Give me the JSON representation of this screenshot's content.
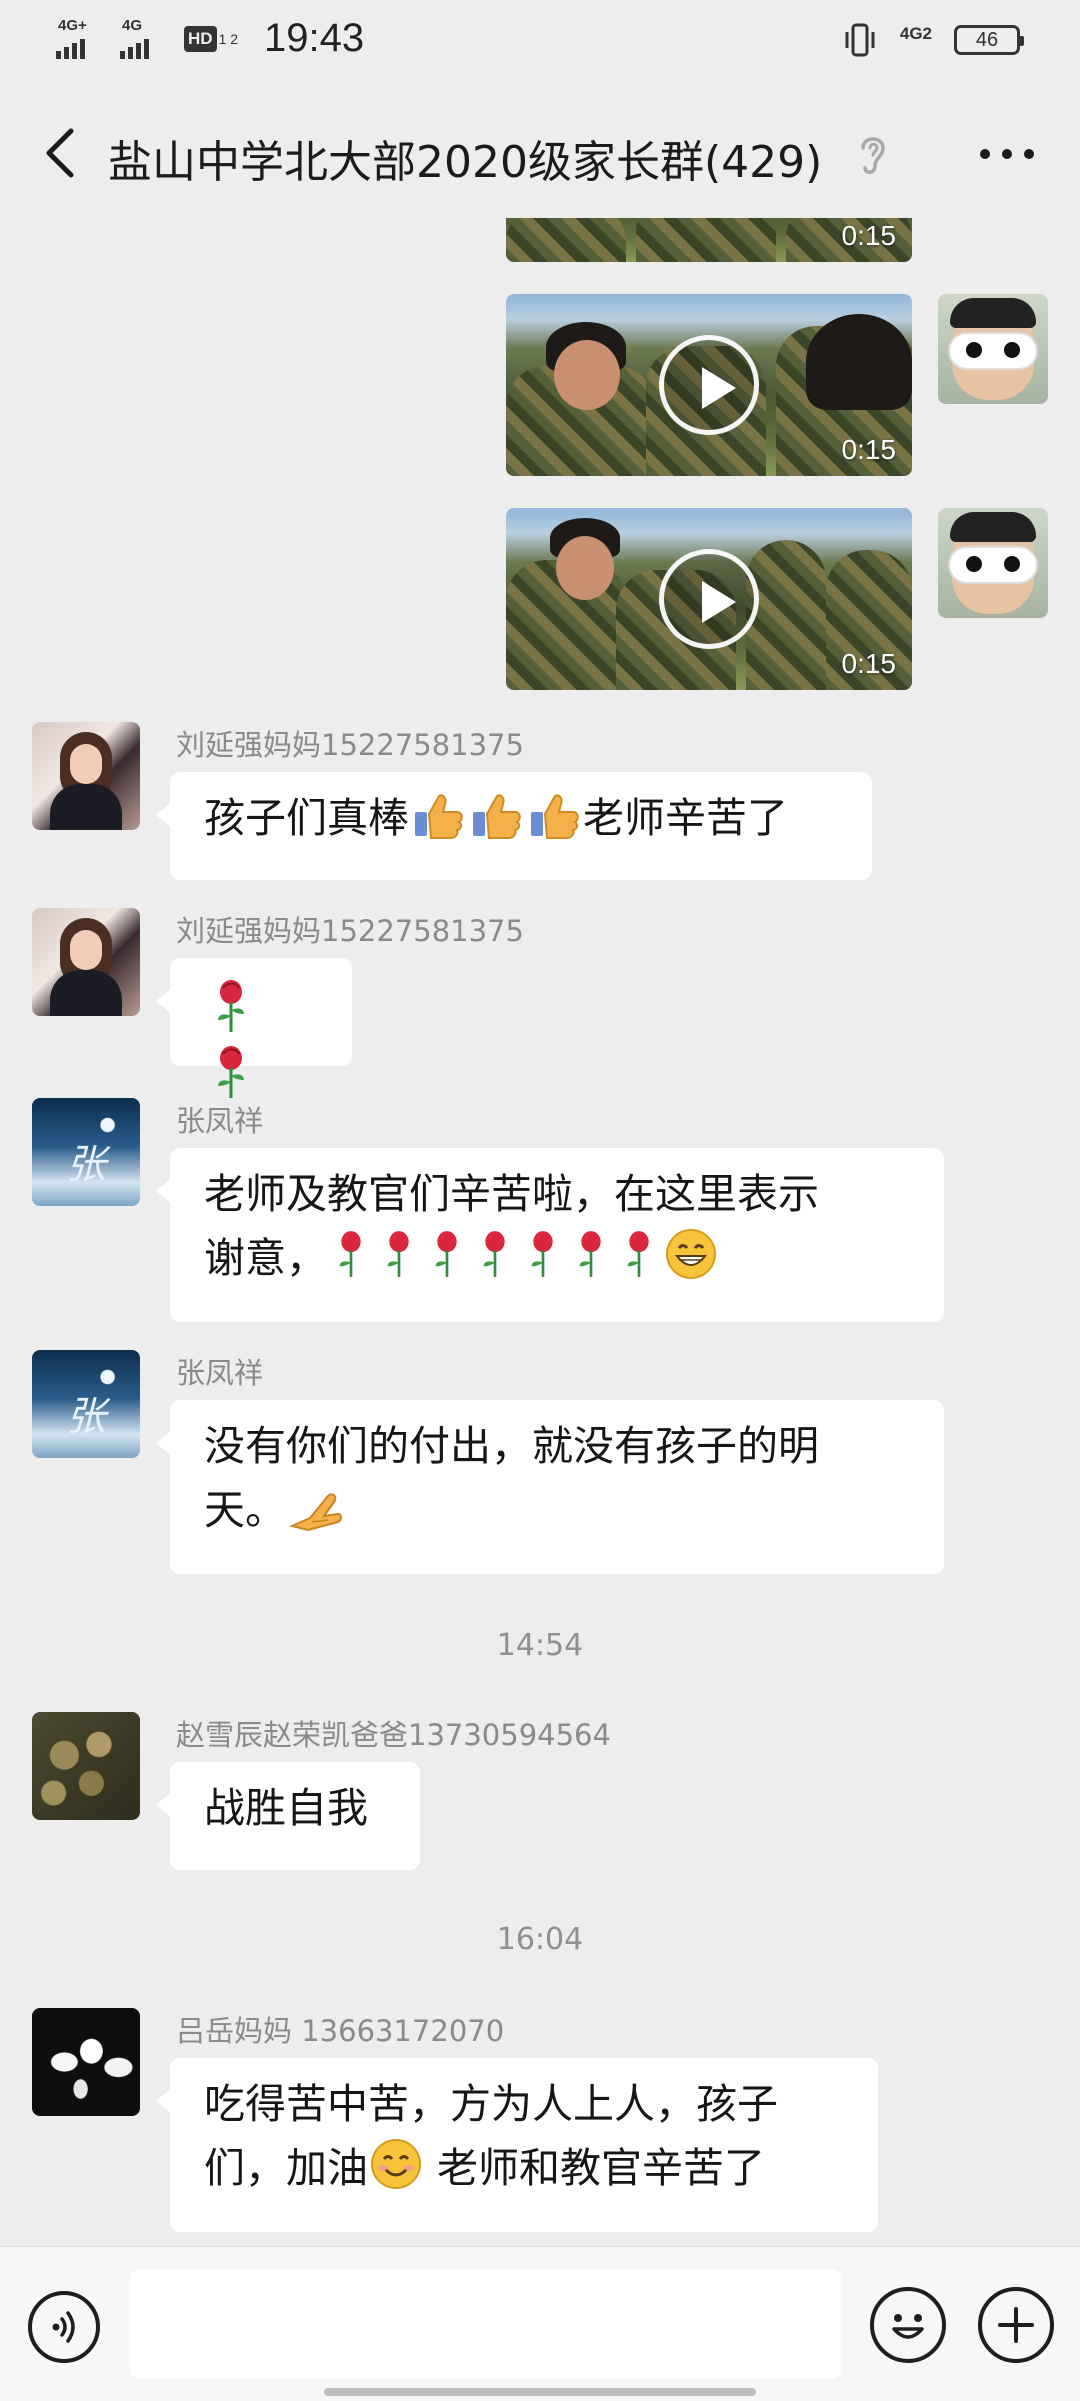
{
  "status_bar": {
    "time": "19:43",
    "signal_1": "4G+",
    "signal_2": "4G",
    "hd_label": "HD",
    "hd_sub": "1 2",
    "net_right": "4G2",
    "battery": "46"
  },
  "nav": {
    "title": "盐山中学北大部2020级家长群(429)"
  },
  "videos": [
    {
      "duration": "0:15"
    },
    {
      "duration": "0:15"
    },
    {
      "duration": "0:15"
    }
  ],
  "messages": [
    {
      "sender": "刘延强妈妈15227581375",
      "text_before": "孩子们真棒",
      "text_after": "老师辛苦了"
    },
    {
      "sender": "刘延强妈妈15227581375"
    },
    {
      "sender": "张凤祥",
      "line1": "老师及教官们辛苦啦，在这里表示",
      "line2": "谢意，"
    },
    {
      "sender": "张凤祥",
      "line1": "没有你们的付出，就没有孩子的明",
      "line2": "天。"
    },
    {
      "sender": "赵雪辰赵荣凯爸爸13730594564",
      "text": "战胜自我"
    },
    {
      "sender": "吕岳妈妈 13663172070",
      "line1": "吃得苦中苦，方为人上人，孩子",
      "line2_before": "们，加油",
      "line2_after": " 老师和教官辛苦了"
    }
  ],
  "timestamps": [
    "14:54",
    "16:04"
  ],
  "avatar_glyph": "张",
  "input": {
    "placeholder": ""
  },
  "icons": {
    "back": "back-arrow-icon",
    "ear": "ear-icon",
    "more": "more-dots-icon",
    "voice": "voice-icon",
    "emoji": "emoji-icon",
    "plus": "plus-icon",
    "thumbs_up": "thumbs-up-emoji",
    "rose": "rose-emoji",
    "grin": "grin-emoji",
    "smile": "smile-emoji",
    "fist_bump": "hand-emoji"
  }
}
